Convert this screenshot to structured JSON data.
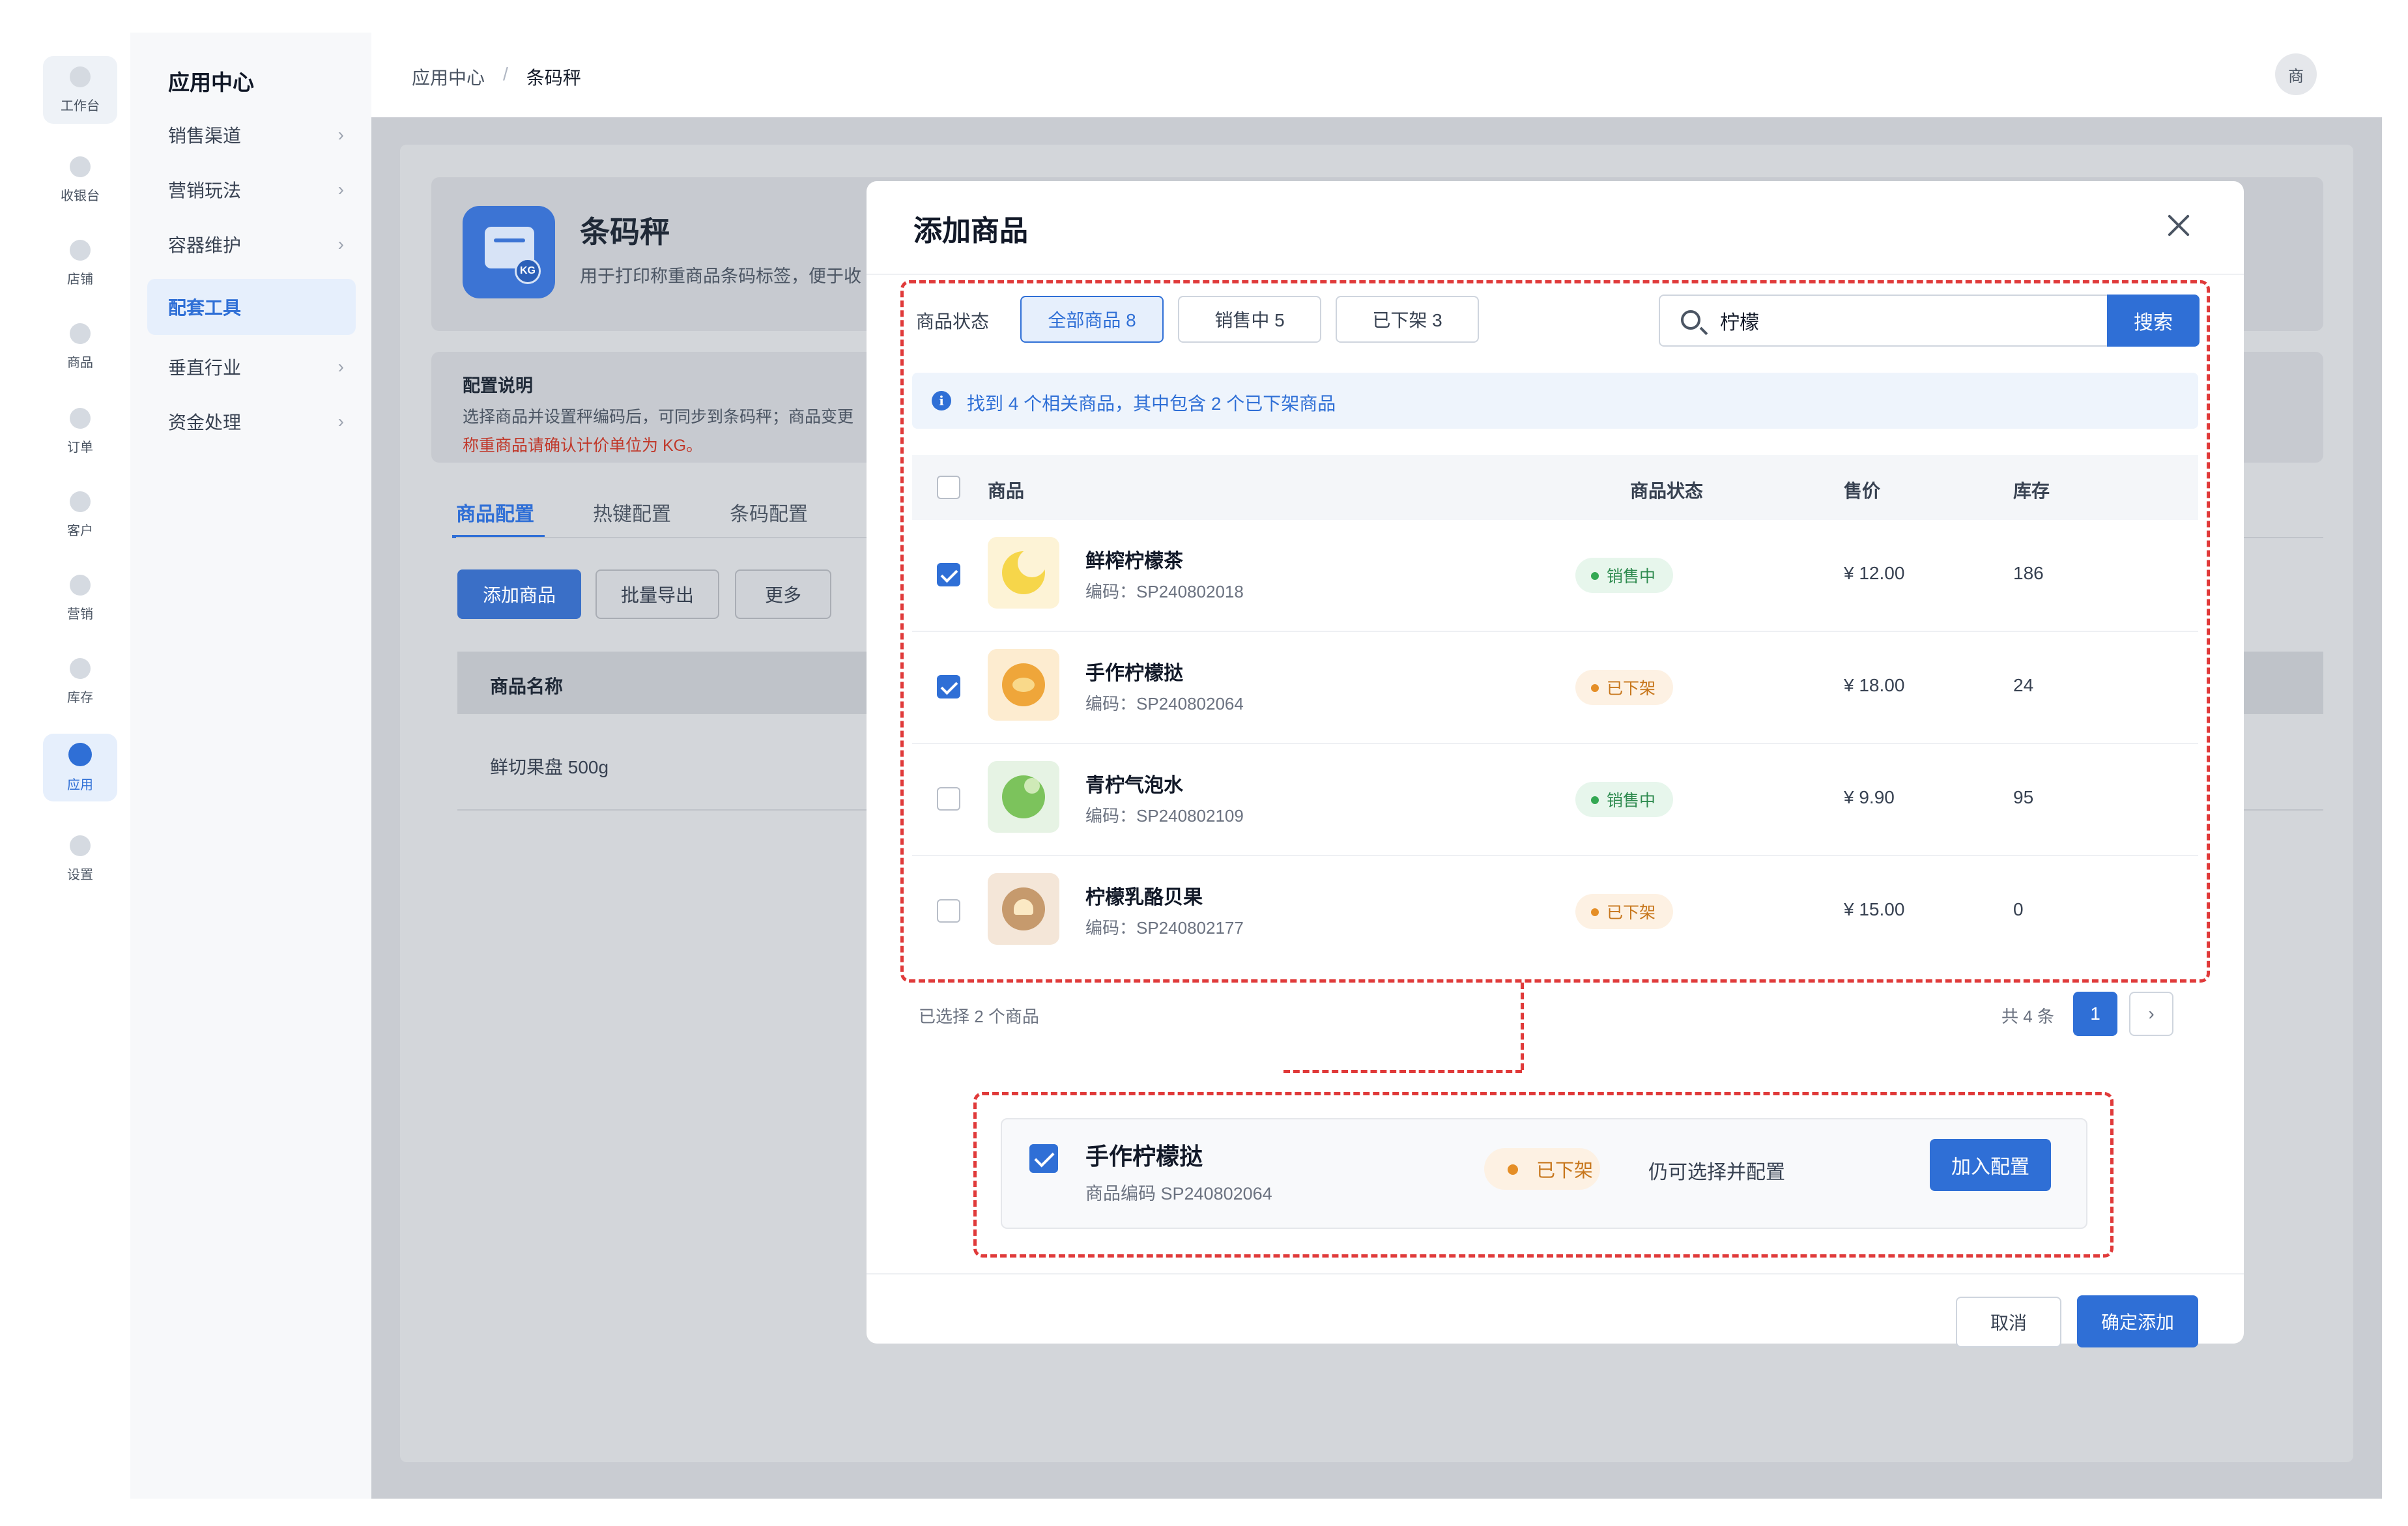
{
  "rail": {
    "items": [
      {
        "label": "工作台"
      },
      {
        "label": "收银台"
      },
      {
        "label": "店铺"
      },
      {
        "label": "商品"
      },
      {
        "label": "订单"
      },
      {
        "label": "客户"
      },
      {
        "label": "营销"
      },
      {
        "label": "库存"
      },
      {
        "label": "应用"
      },
      {
        "label": "设置"
      }
    ],
    "active": "应用"
  },
  "menu": {
    "title": "应用中心",
    "items": [
      {
        "label": "销售渠道",
        "chevron": "›"
      },
      {
        "label": "营销玩法",
        "chevron": "›"
      },
      {
        "label": "容器维护",
        "chevron": "›"
      },
      {
        "label": "配套工具"
      },
      {
        "label": "垂直行业",
        "chevron": "›"
      },
      {
        "label": "资金处理",
        "chevron": "›"
      }
    ]
  },
  "breadcrumb": {
    "root": "应用中心",
    "sep": "/",
    "current": "条码秤"
  },
  "avatar": {
    "text": "商"
  },
  "background": {
    "app_name": "条码秤",
    "app_desc": "用于打印称重商品条码标签，便于收",
    "icon_badge": "KG",
    "notice_title": "配置说明",
    "notice_line": "选择商品并设置秤编码后，可同步到条码秤；商品变更",
    "notice_warn": "称重商品请确认计价单位为 KG。",
    "tabs": [
      "商品配置",
      "热键配置",
      "条码配置"
    ],
    "buttons": {
      "add": "添加商品",
      "export": "批量导出",
      "more": "更多"
    },
    "table_header": "商品名称",
    "row_text": "鲜切果盘 500g"
  },
  "modal": {
    "title": "添加商品",
    "filter_label": "商品状态",
    "filters": [
      {
        "label": "全部商品 8",
        "active": true
      },
      {
        "label": "销售中 5",
        "active": false
      },
      {
        "label": "已下架 3",
        "active": false
      }
    ],
    "search": {
      "value": "柠檬",
      "button": "搜索"
    },
    "info": "找到 4 个相关商品，其中包含 2 个已下架商品",
    "columns": {
      "product": "商品",
      "status": "商品状态",
      "price": "售价",
      "stock": "库存"
    },
    "rows": [
      {
        "name": "鲜榨柠檬茶",
        "code": "编码：SP240802018",
        "status": "销售中",
        "status_type": "sale",
        "price": "¥ 12.00",
        "stock": "186",
        "checked": true
      },
      {
        "name": "手作柠檬挞",
        "code": "编码：SP240802064",
        "status": "已下架",
        "status_type": "off",
        "price": "¥ 18.00",
        "stock": "24",
        "checked": true
      },
      {
        "name": "青柠气泡水",
        "code": "编码：SP240802109",
        "status": "销售中",
        "status_type": "sale",
        "price": "¥ 9.90",
        "stock": "95",
        "checked": false
      },
      {
        "name": "柠檬乳酪贝果",
        "code": "编码：SP240802177",
        "status": "已下架",
        "status_type": "off",
        "price": "¥ 15.00",
        "stock": "0",
        "checked": false
      }
    ],
    "selected_count": "已选择 2 个商品",
    "total": "共 4 条",
    "page": "1",
    "next": "›",
    "detail": {
      "name": "手作柠檬挞",
      "code": "商品编码 SP240802064",
      "status": "已下架",
      "note": "仍可选择并配置",
      "button": "加入配置"
    },
    "cancel": "取消",
    "confirm": "确定添加"
  },
  "colors": {
    "accent": "#2f6fd6",
    "highlight": "#e03a3a",
    "sale": "#34a853",
    "off": "#e58e26"
  }
}
